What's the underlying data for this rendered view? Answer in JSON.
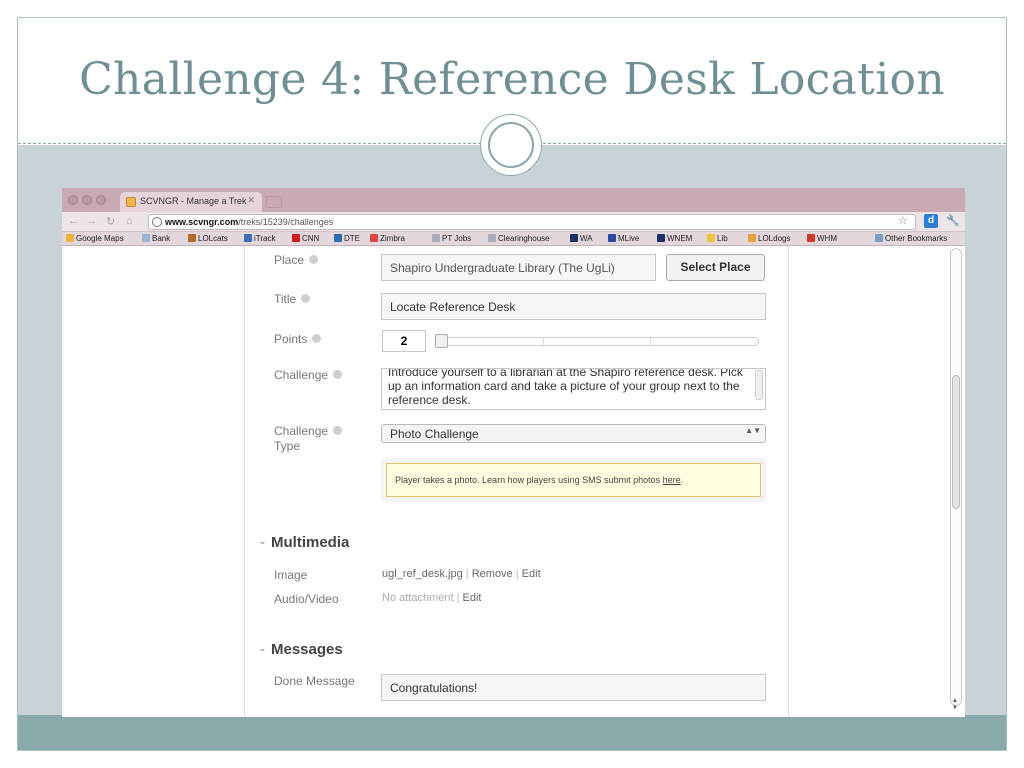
{
  "slide": {
    "title": "Challenge 4: Reference Desk Location"
  },
  "browser": {
    "tab_title": "SCVNGR - Manage a Trek",
    "url_host": "www.scvngr.com",
    "url_path": "/treks/15239/challenges",
    "bookmarks": [
      "Google Maps",
      "Bank",
      "LOLcats",
      "iTrack",
      "CNN",
      "DTE",
      "Zimbra",
      "PT Jobs",
      "Clearinghouse",
      "WA",
      "MLive",
      "WNEM",
      "Lib",
      "LOLdogs",
      "WHM",
      "Other Bookmarks"
    ]
  },
  "form": {
    "place_label": "Place",
    "place_value": "Shapiro Undergraduate Library (The UgLi)",
    "select_place_label": "Select Place",
    "title_label": "Title",
    "title_value": "Locate Reference Desk",
    "points_label": "Points",
    "points_value": "2",
    "points_fraction": 0.0,
    "challenge_label": "Challenge",
    "challenge_value": "Introduce yourself to a librarian at the Shapiro reference desk. Pick up an information card and take a picture of your group next to the reference desk.",
    "type_label_1": "Challenge",
    "type_label_2": "Type",
    "type_value": "Photo Challenge",
    "hint_text": "Player takes a photo. Learn how players using SMS submit photos ",
    "hint_link": "here",
    "hint_end": "."
  },
  "multimedia": {
    "heading": "Multimedia",
    "dash": "-",
    "image_label": "Image",
    "image_file": "ugl_ref_desk.jpg",
    "remove_label": "Remove",
    "edit_label": "Edit",
    "av_label": "Audio/Video",
    "av_value": "No attachment",
    "av_edit_label": "Edit",
    "separator": "|"
  },
  "messages": {
    "heading": "Messages",
    "dash": "-",
    "done_label": "Done Message",
    "done_value": "Congratulations!"
  },
  "colors": {
    "title": "#6f8f95",
    "slide_bg": "#c7d3d7",
    "footer": "#8aa9ab",
    "tabstrip": "#c8a9b4"
  }
}
